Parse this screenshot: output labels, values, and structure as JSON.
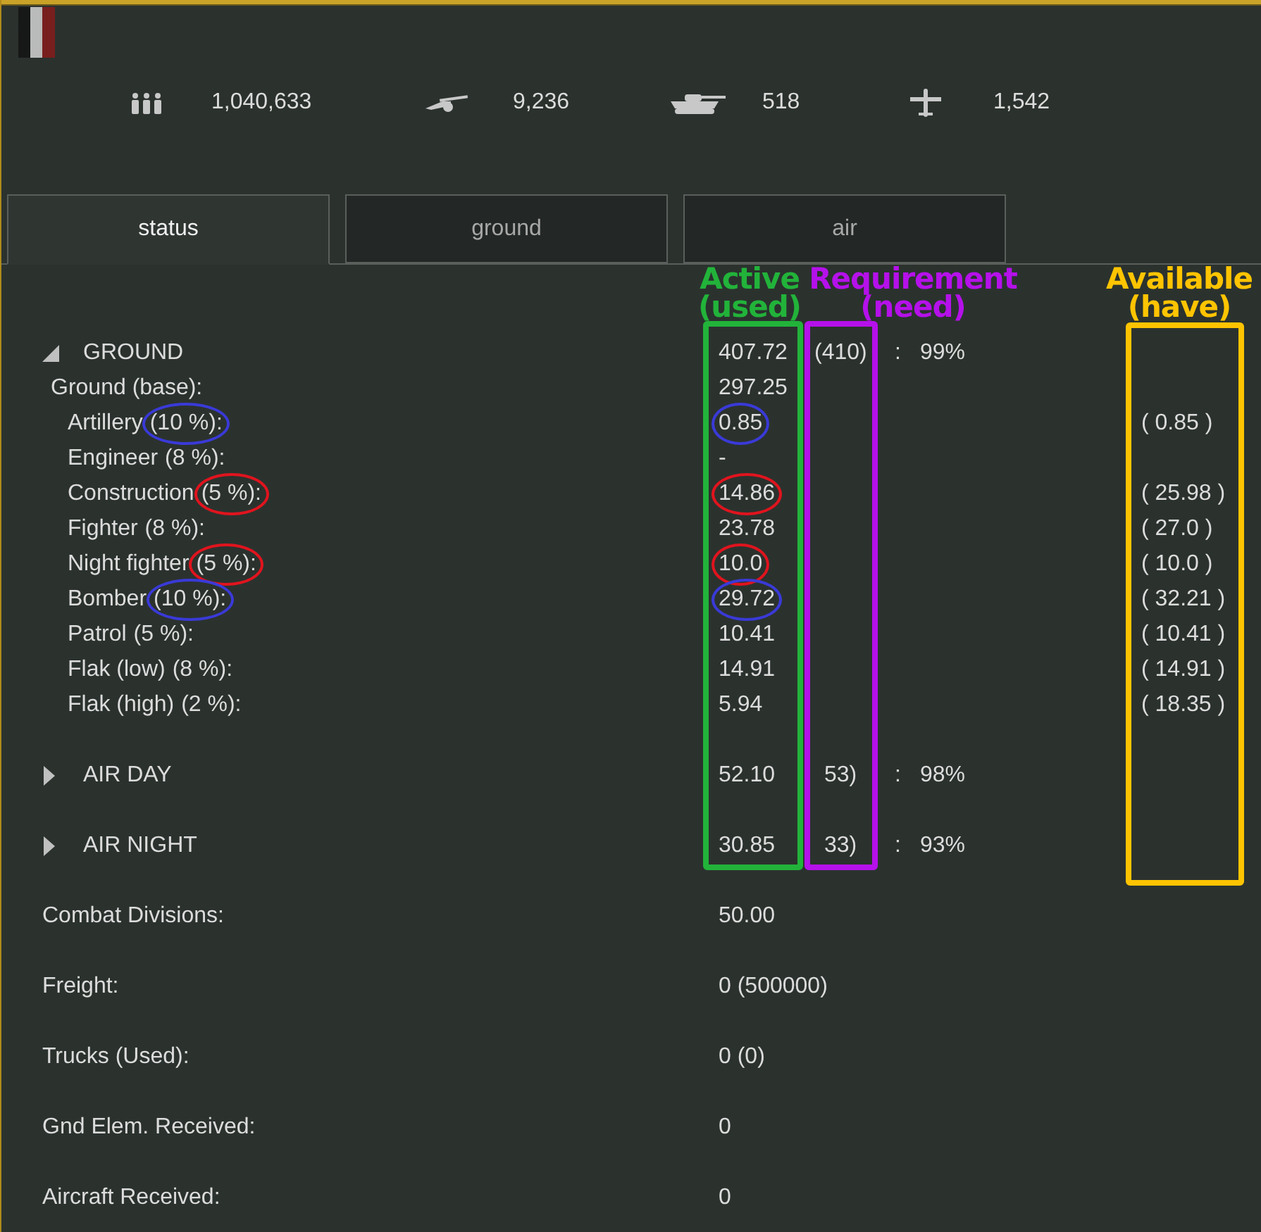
{
  "stats": [
    {
      "kind": "people",
      "value": "1,040,633"
    },
    {
      "kind": "gun",
      "value": "9,236"
    },
    {
      "kind": "tank",
      "value": "518"
    },
    {
      "kind": "plane",
      "value": "1,542"
    }
  ],
  "tabs": [
    {
      "label": "status",
      "selected": true
    },
    {
      "label": "ground",
      "selected": false
    },
    {
      "label": "air",
      "selected": false
    }
  ],
  "tree": [
    {
      "label": "GROUND",
      "expanded": true,
      "active": "407.72",
      "requirement": "(410)",
      "separator": ":",
      "ratio": "99%",
      "children": [
        {
          "label": "Ground (base):",
          "active": "297.25",
          "children": [
            {
              "name": "Artillery",
              "share": "(10 %):",
              "share_circle": {
                "color": "#3a3ad8"
              },
              "active": "0.85",
              "active_circle": {
                "color": "#3a3ad8"
              },
              "available": "( 0.85 )"
            },
            {
              "name": "Engineer",
              "share": "(8 %):",
              "active": "-"
            },
            {
              "name": "Construction",
              "share": "(5 %):",
              "share_circle": {
                "color": "#e0141e"
              },
              "active": "14.86",
              "active_circle": {
                "color": "#e0141e"
              },
              "available": "( 25.98 )"
            },
            {
              "name": "Fighter",
              "share": "(8 %):",
              "active": "23.78",
              "available": "( 27.0 )"
            },
            {
              "name": "Night fighter",
              "share": "(5 %):",
              "share_circle": {
                "color": "#e0141e"
              },
              "active": "10.0",
              "active_circle": {
                "color": "#e0141e"
              },
              "available": "( 10.0 )"
            },
            {
              "name": "Bomber",
              "share": "(10 %):",
              "share_circle": {
                "color": "#3a3ad8"
              },
              "active": "29.72",
              "active_circle": {
                "color": "#3a3ad8"
              },
              "available": "( 32.21 )"
            },
            {
              "name": "Patrol",
              "share": "(5 %):",
              "active": "10.41",
              "available": "( 10.41 )"
            },
            {
              "name": "Flak (low)",
              "share": "(8 %):",
              "active": "14.91",
              "available": "( 14.91 )"
            },
            {
              "name": "Flak (high)",
              "share": "(2 %):",
              "active": "5.94",
              "available": "( 18.35 )"
            }
          ]
        }
      ]
    },
    {
      "label": "AIR DAY",
      "expanded": false,
      "active": "52.10",
      "requirement": "53)",
      "separator": ":",
      "ratio": "98%"
    },
    {
      "label": "AIR NIGHT",
      "expanded": false,
      "active": "30.85",
      "requirement": "33)",
      "separator": ":",
      "ratio": "93%"
    }
  ],
  "summary": [
    {
      "label": "Combat Divisions:",
      "value": "50.00"
    },
    {
      "label": "Freight:",
      "value": "0 (500000)"
    },
    {
      "label": "Trucks (Used):",
      "value": "0 (0)"
    },
    {
      "label": "Gnd Elem. Received:",
      "value": "0"
    },
    {
      "label": "Aircraft Received:",
      "value": "0"
    }
  ],
  "annotations": [
    {
      "kind": "active",
      "lines": [
        "Active",
        "(used)"
      ],
      "color": "#22b33a"
    },
    {
      "kind": "requirement",
      "lines": [
        "Requirement",
        "(need)"
      ],
      "color": "#b511ea"
    },
    {
      "kind": "available",
      "lines": [
        "Available",
        "(have)"
      ],
      "color": "#ffc400"
    }
  ]
}
